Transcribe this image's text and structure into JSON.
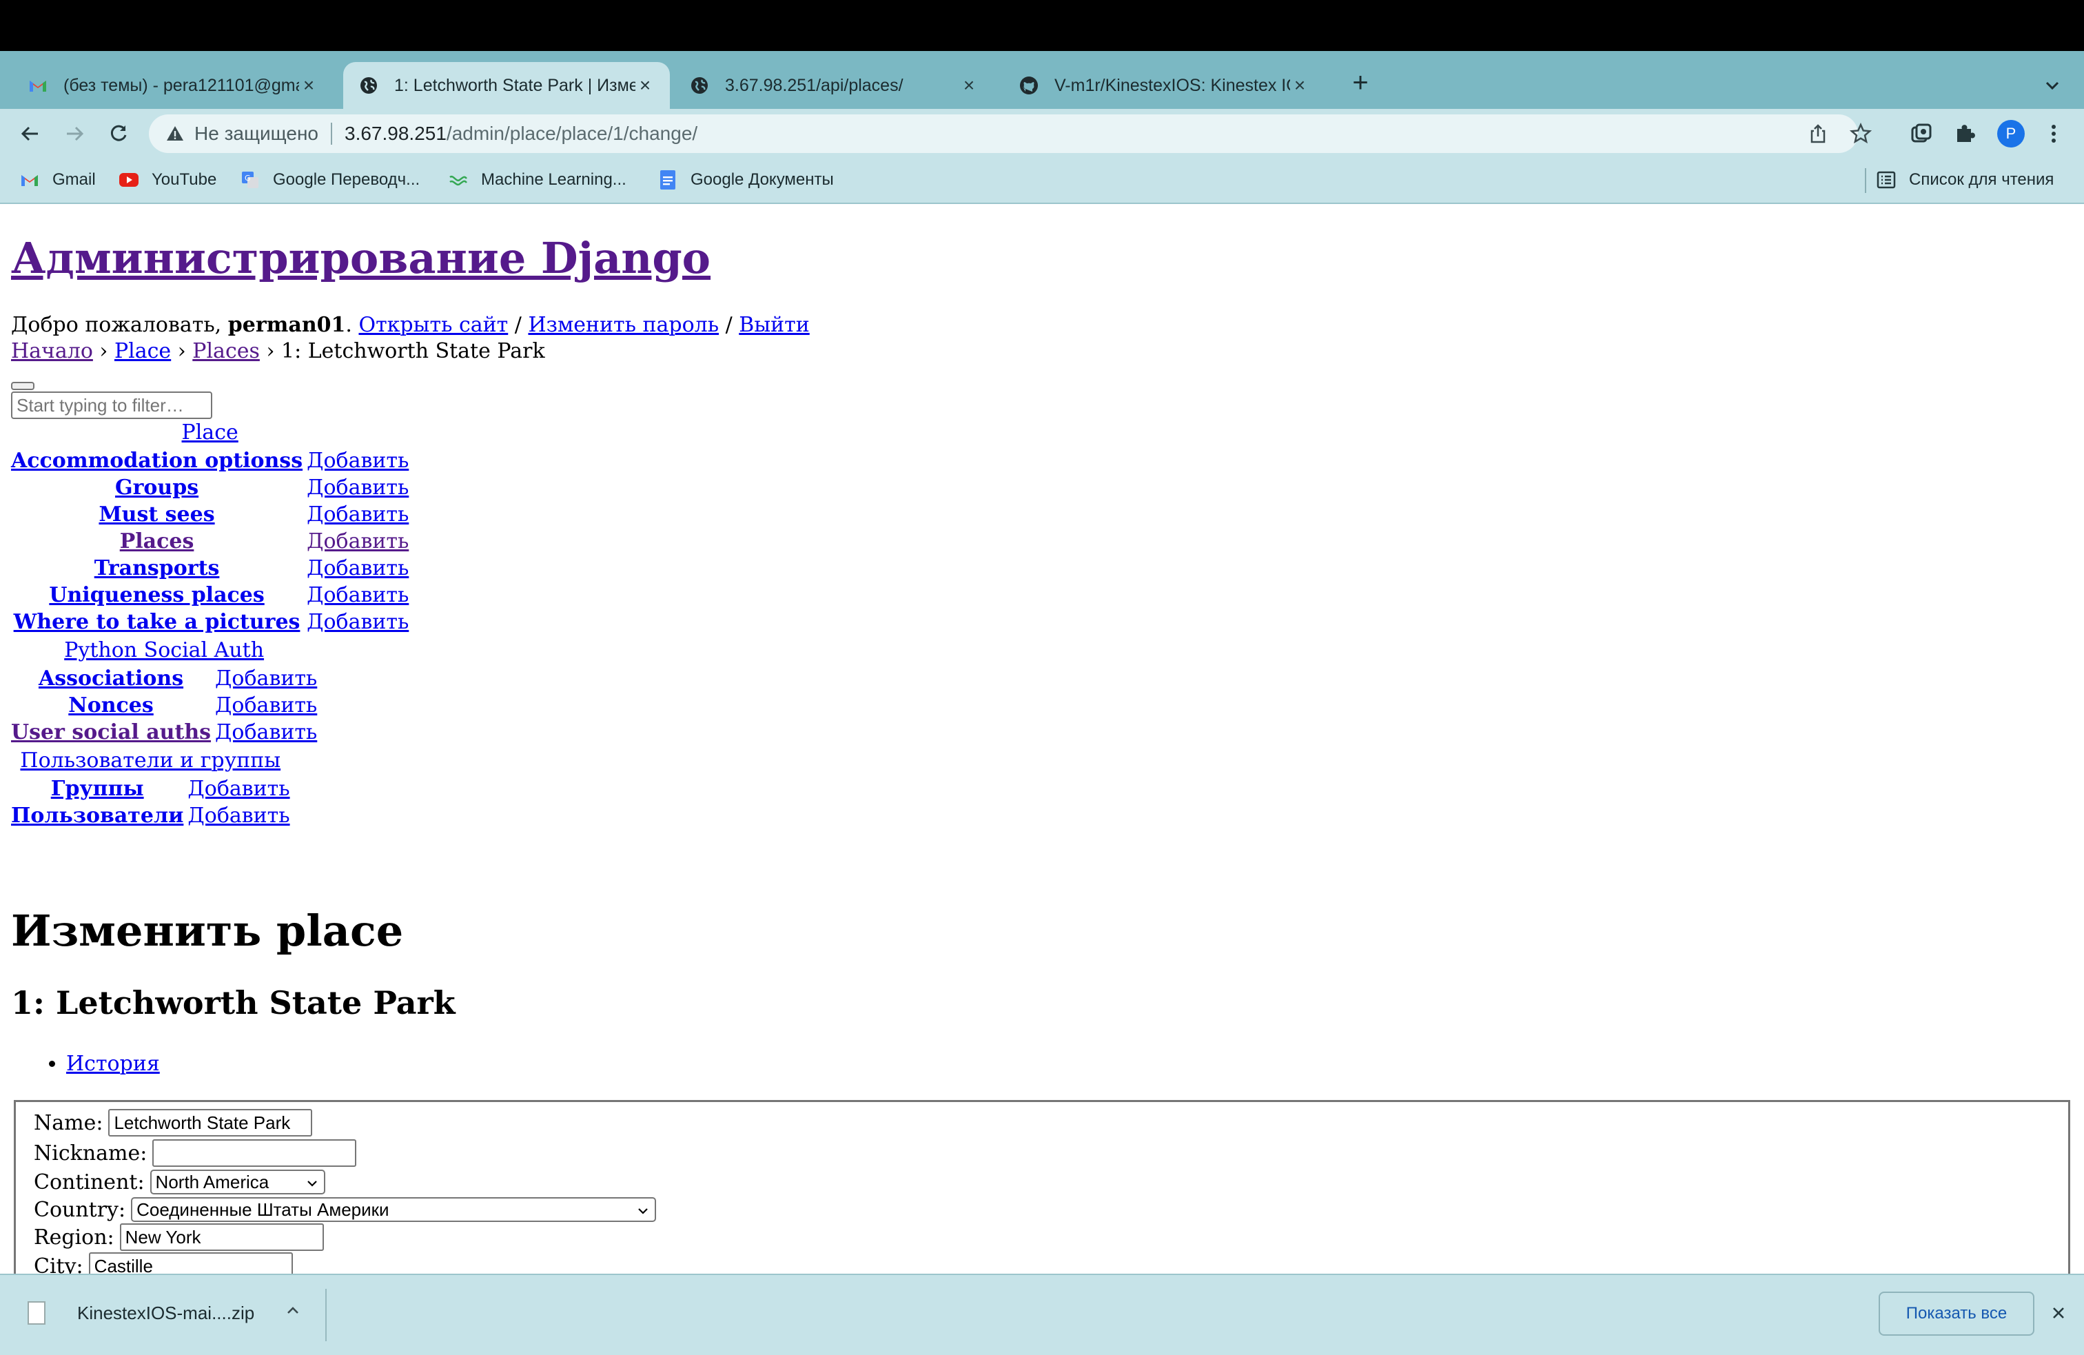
{
  "browser": {
    "tabs": [
      {
        "title": "(без темы) - pera121101@gma",
        "icon": "gmail-icon",
        "active": false
      },
      {
        "title": "1: Letchworth State Park | Изме",
        "icon": "globe-icon",
        "active": true
      },
      {
        "title": "3.67.98.251/api/places/",
        "icon": "globe-icon",
        "active": false
      },
      {
        "title": "V-m1r/KinestexIOS: Kinestex IO",
        "icon": "github-icon",
        "active": false
      }
    ],
    "new_tab": "+",
    "security_label": "Не защищено",
    "url_host": "3.67.98.251",
    "url_path": "/admin/place/place/1/change/",
    "profile_initial": "P",
    "bookmarks": [
      {
        "label": "Gmail",
        "icon": "gmail-icon"
      },
      {
        "label": "YouTube",
        "icon": "youtube-icon"
      },
      {
        "label": "Google Переводч...",
        "icon": "google-translate-icon"
      },
      {
        "label": "Machine Learning...",
        "icon": "ml-icon"
      },
      {
        "label": "Google Документы",
        "icon": "google-docs-icon"
      }
    ],
    "reading_list": "Список для чтения"
  },
  "admin": {
    "site_title": "Администрирование Django",
    "welcome_prefix": "Добро пожаловать, ",
    "username": "perman01",
    "welcome_suffix": ". ",
    "view_site": "Открыть сайт",
    "change_password": "Изменить пароль",
    "logout": "Выйти",
    "slash": " / ",
    "breadcrumbs": {
      "home": "Начало",
      "app": "Place",
      "model": "Places",
      "current": "1: Letchworth State Park",
      "sep": " › "
    },
    "filter_placeholder": "Start typing to filter…",
    "add_label": "Добавить",
    "apps": [
      {
        "name": "Place",
        "models": [
          "Accommodation optionss",
          "Groups",
          "Must sees",
          "Places",
          "Transports",
          "Uniqueness places",
          "Where to take a pictures"
        ]
      },
      {
        "name": "Python Social Auth",
        "models": [
          "Associations",
          "Nonces",
          "User social auths"
        ]
      },
      {
        "name": "Пользователи и группы",
        "models": [
          "Группы",
          "Пользователи"
        ]
      }
    ],
    "page_heading": "Изменить place",
    "object_heading": "1: Letchworth State Park",
    "history_link": "История",
    "form": {
      "name_label": "Name:",
      "name_value": "Letchworth State Park",
      "nickname_label": "Nickname:",
      "nickname_value": "",
      "continent_label": "Continent:",
      "continent_value": "North America",
      "country_label": "Country:",
      "country_value": "Соединенные Штаты Америки",
      "region_label": "Region:",
      "region_value": "New York",
      "city_label": "City:",
      "city_value": "Castille"
    }
  },
  "downloads": {
    "filename": "KinestexIOS-mai....zip",
    "show_all": "Показать все"
  }
}
